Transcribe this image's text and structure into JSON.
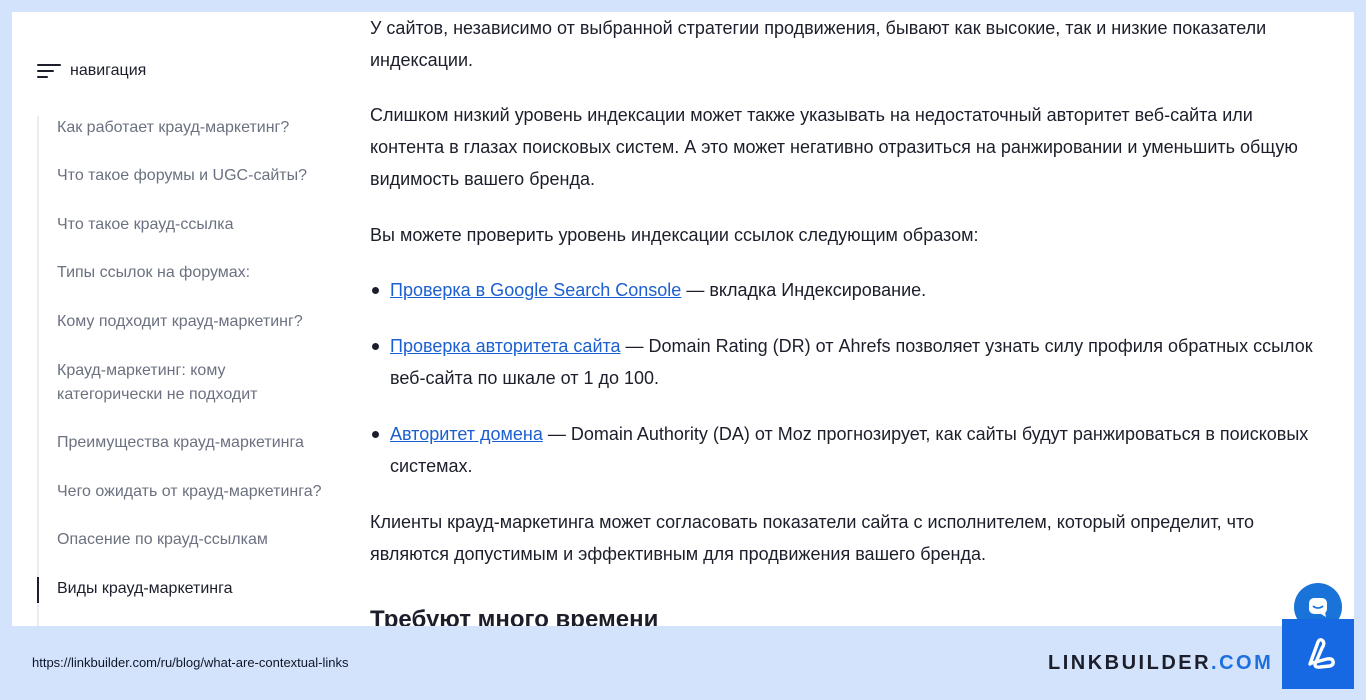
{
  "navigation": {
    "title": "навигация",
    "items": [
      {
        "label": "Как работает крауд-маркетинг?"
      },
      {
        "label": "Что такое форумы и UGC-сайты?"
      },
      {
        "label": "Что такое крауд-ссылка"
      },
      {
        "label": "Типы ссылок на форумах:"
      },
      {
        "label": "Кому подходит крауд-маркетинг?"
      },
      {
        "label": "Крауд-маркетинг: кому категорически не подходит"
      },
      {
        "label": "Преимущества крауд-маркетинга"
      },
      {
        "label": "Чего ожидать от крауд-маркетинга?"
      },
      {
        "label": "Опасение по крауд-ссылкам"
      },
      {
        "label": "Виды крауд-маркетинга",
        "active": true
      }
    ]
  },
  "article": {
    "paragraphs": [
      "У сайтов, независимо от выбранной стратегии продвижения, бывают как высокие, так и низкие показатели индексации.",
      "Слишком низкий уровень индексации может также указывать на недостаточный авторитет веб-сайта или контента в глазах поисковых систем. А это может негативно отразиться на ранжировании и уменьшить общую видимость вашего бренда.",
      "Вы можете проверить уровень индексации ссылок следующим образом:"
    ],
    "list": [
      {
        "link": "Проверка в Google Search Console",
        "text": " — вкладка Индексирование."
      },
      {
        "link": "Проверка авторитета сайта",
        "text": " — Domain Rating (DR) от Ahrefs позволяет узнать силу профиля обратных ссылок веб-сайта по шкале от 1 до 100."
      },
      {
        "link": "Авторитет домена",
        "text": " — Domain Authority (DA) от Moz прогнозирует, как сайты будут ранжироваться в поисковых системах."
      }
    ],
    "closing_paragraph": "Клиенты крауд-маркетинга может согласовать показатели сайта с исполнителем, который определит, что являются допустимым и эффективным для продвижения вашего бренда.",
    "next_heading": "Требуют много времени"
  },
  "footer": {
    "url": "https://linkbuilder.com/ru/blog/what-are-contextual-links",
    "brand_name": "LINKBUILDER",
    "brand_tld": ".COM"
  },
  "icons": {
    "menu": "menu-icon",
    "chat": "chat-icon",
    "logo": "linkbuilder-logo-icon"
  },
  "colors": {
    "link": "#1b5fd1",
    "accent": "#1668e3",
    "background": "#d3e3fb"
  }
}
